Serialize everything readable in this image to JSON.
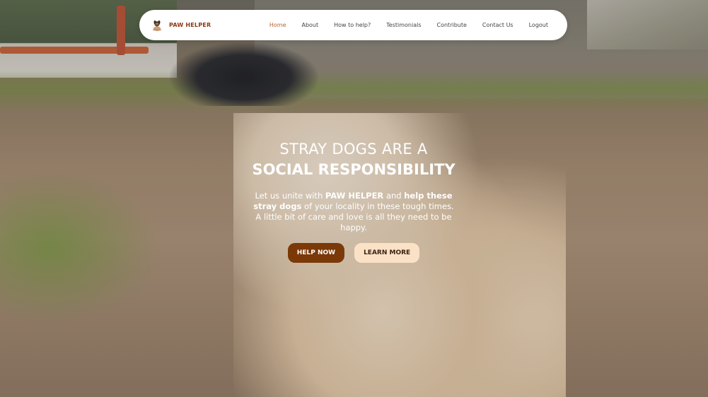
{
  "brand": {
    "name": "PAW HELPER",
    "logo_icon": "dog-icon"
  },
  "nav": {
    "items": [
      {
        "label": "Home",
        "active": true
      },
      {
        "label": "About",
        "active": false
      },
      {
        "label": "How to help?",
        "active": false
      },
      {
        "label": "Testimonials",
        "active": false
      },
      {
        "label": "Contribute",
        "active": false
      },
      {
        "label": "Contact Us",
        "active": false
      },
      {
        "label": "Logout",
        "active": false
      }
    ]
  },
  "hero": {
    "headline_line1": "STRAY DOGS ARE A",
    "headline_line2": "SOCIAL RESPONSIBILITY",
    "desc_part1": "Let us unite with ",
    "desc_brand": "PAW HELPER",
    "desc_part2": " and ",
    "desc_bold": "help these stray dogs",
    "desc_part3": " of your locality in these tough times. A little bit of care and love is all they need to be happy.",
    "primary_button": "HELP NOW",
    "secondary_button": "LEARN MORE"
  },
  "colors": {
    "brand": "#8a3a14",
    "nav_active": "#b5642d",
    "primary_button_bg": "#7a3907",
    "secondary_button_bg": "#fbe1c6"
  }
}
